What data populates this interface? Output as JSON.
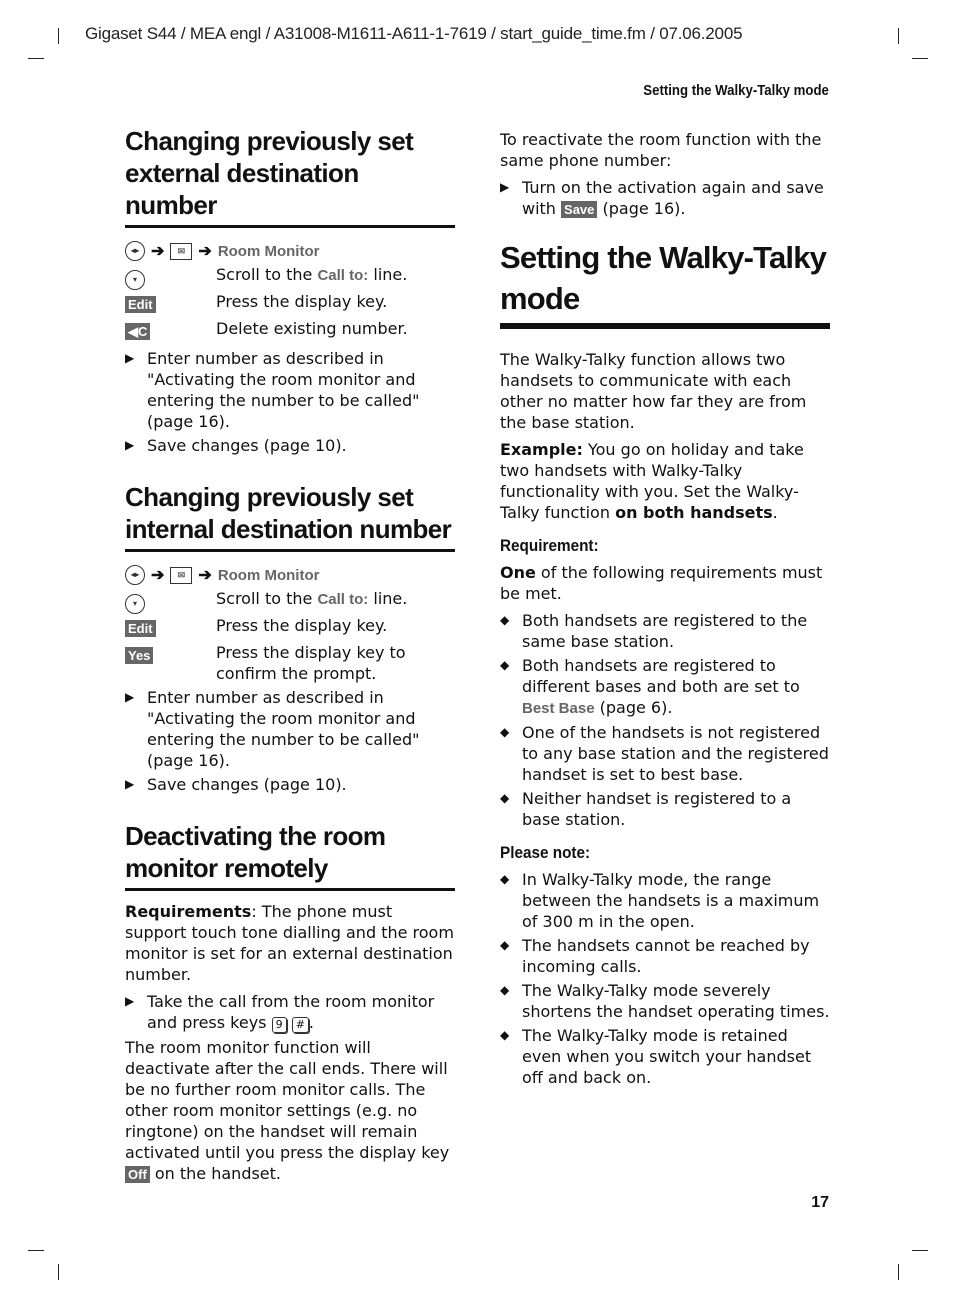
{
  "header": {
    "meta": "Gigaset S44 / MEA engl / A31008-M1611-A611-1-7619 / start_guide_time.fm / 07.06.2005",
    "running_head": "Setting the Walky-Talky mode",
    "page_number": "17"
  },
  "left": {
    "sec1": {
      "title": "Changing previously set external destination number",
      "nav_target": "Room Monitor",
      "steps": [
        {
          "key": "nav",
          "pre": "Scroll to the ",
          "ui": "Call to:",
          "post": " line."
        },
        {
          "key": "Edit",
          "text": "Press the display key."
        },
        {
          "key": "◀C",
          "text": "Delete existing number."
        }
      ],
      "bullets": [
        "Enter number as described in \"Activating the room monitor and entering the number to be called\" (page 16).",
        "Save changes (page 10)."
      ]
    },
    "sec2": {
      "title": "Changing previously set internal destination number",
      "nav_target": "Room Monitor",
      "steps": [
        {
          "key": "nav",
          "pre": "Scroll to the ",
          "ui": "Call to:",
          "post": " line."
        },
        {
          "key": "Edit",
          "text": "Press the display key."
        },
        {
          "key": "Yes",
          "text": "Press the display key to confirm the prompt."
        }
      ],
      "bullets": [
        "Enter number as described in \"Activating the room monitor and entering the number to be called\" (page 16).",
        "Save changes (page 10)."
      ]
    },
    "sec3": {
      "title": "Deactivating the room monitor remotely",
      "req_label": "Requirements",
      "req_text": ": The phone must support touch tone dialling and the room monitor is set for an external destination number.",
      "bullet_pre": "Take the call from the room monitor and press keys ",
      "key1": "9",
      "key2": "#",
      "bullet_post": ".",
      "para_pre": "The room monitor function will deactivate after the call ends. There will be no further room monitor calls. The other room monitor settings (e.g. no ringtone) on the handset will remain activated until you press the display key ",
      "off_key": "Off",
      "para_post": " on the handset."
    }
  },
  "right": {
    "intro": "To reactivate the room function with the same phone number:",
    "intro_bullet_pre": "Turn on the activation again and save with ",
    "save_key": "Save",
    "intro_bullet_post": " (page 16).",
    "title": "Setting the Walky-Talky mode",
    "desc": "The Walky-Talky function allows two handsets to communicate with each other no matter how far they are from the base station.",
    "example_label": "Example:",
    "example_text": " You go on holiday and take two handsets with Walky-Talky functionality with you. Set the Walky-Talky function ",
    "example_bold": "on both handsets",
    "example_end": ".",
    "req_heading": "Requirement:",
    "req_bold": "One",
    "req_text": " of the following requirements must be met.",
    "req_items": [
      {
        "text": "Both handsets are registered to the same base station."
      },
      {
        "text": "Both handsets are registered to different bases and both are set to ",
        "ui": "Best Base",
        "post": " (page 6)."
      },
      {
        "text": "One of the handsets is not registered to any base station and the registered handset is set to best base."
      },
      {
        "text": "Neither handset is registered to a base station."
      }
    ],
    "note_heading": "Please note:",
    "notes": [
      "In Walky-Talky mode, the range between the handsets is a maximum of 300 m in the open.",
      "The handsets cannot be reached by incoming calls.",
      "The Walky-Talky mode severely shortens the handset operating times.",
      "The Walky-Talky mode is retained even when you switch your handset off and back on."
    ]
  }
}
